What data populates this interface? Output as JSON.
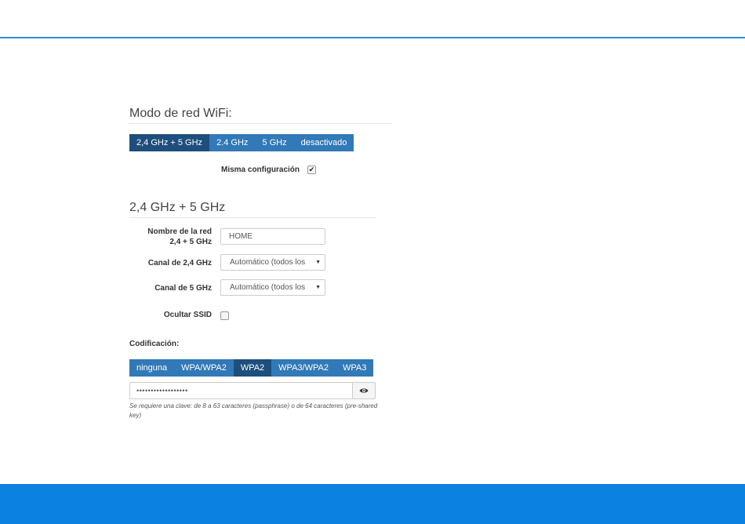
{
  "wifi_mode": {
    "title": "Modo de red WiFi:",
    "options": [
      "2,4 GHz + 5 GHz",
      "2.4 GHz",
      "5 GHz",
      "desactivado"
    ],
    "selected": "2,4 GHz + 5 GHz"
  },
  "same_config": {
    "label": "Misma configuración",
    "checked": true,
    "check_glyph": "✔"
  },
  "band_section": {
    "title": "2,4 GHz + 5 GHz",
    "network_name_label_line1": "Nombre de la red",
    "network_name_label_line2": "2,4 + 5 GHz",
    "network_name_value": "HOME",
    "channel_24_label": "Canal de 2,4 GHz",
    "channel_24_value": "Automático (todos los",
    "channel_5_label": "Canal de 5 GHz",
    "channel_5_value": "Automático (todos los",
    "select_arrow": "▼",
    "hide_ssid_label": "Ocultar SSID",
    "hide_ssid_checked": false
  },
  "encryption": {
    "label": "Codificación:",
    "options": [
      "ninguna",
      "WPA/WPA2",
      "WPA2",
      "WPA3/WPA2",
      "WPA3"
    ],
    "selected": "WPA2",
    "password_mask": "••••••••••••••••••",
    "hint": "Se requiere una clave: de 8 a 63 caracteres (passphrase) o de 64 caracteres (pre-shared key)",
    "show_password_icon": "eye-icon"
  },
  "colors": {
    "accent": "#3279b7",
    "active": "#1e4e7c",
    "footer": "#0a83e0",
    "top_rule": "#2a8fd8"
  }
}
